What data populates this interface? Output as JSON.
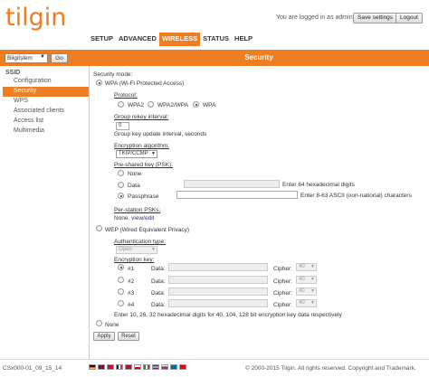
{
  "brand": {
    "logo": "tilgin"
  },
  "header": {
    "logged_text": "You are logged in as admin.",
    "save_label": "Save settings",
    "logout_label": "Logout"
  },
  "nav": [
    "SETUP",
    "ADVANCED",
    "WIRELESS",
    "STATUS",
    "HELP"
  ],
  "nav_active": "WIRELESS",
  "page_title": "Security",
  "ssid_select": {
    "value": "Bilgiİşlem",
    "go_label": "Go"
  },
  "sidebar": {
    "heading": "SSID",
    "items": [
      "Configuration",
      "Security",
      "WPS",
      "Associated clients",
      "Access list",
      "Multimedia"
    ],
    "active": "Security"
  },
  "security": {
    "mode_label": "Security mode:",
    "wpa_label": "WPA (Wi-Fi Protected Access)",
    "protocol_label": "Protocol:",
    "protocols": [
      "WPA2",
      "WPA2/WPA",
      "WPA"
    ],
    "protocol_selected": "WPA",
    "rekey_label": "Group rekey interval:",
    "rekey_value": "0",
    "rekey_help": "Group key update interval, seconds",
    "enc_label": "Encryption algorithm:",
    "enc_value": "TKIP/CCMP",
    "psk_label": "Pre-shared key (PSK):",
    "psk_none": "None",
    "psk_data": "Data",
    "psk_data_help": "Enter 64 hexadecimal digits",
    "psk_pass": "Passphrase",
    "psk_pass_help": "Enter 8-63 ASCII (non-national) characters",
    "per_station_label": "Per-station PSKs:",
    "per_station_value": "None.",
    "view_edit": "view/edit",
    "wep_label": "WEP (Wired Equivalent Privacy)",
    "auth_label": "Authentication type:",
    "auth_value": "Open",
    "enc_key_label": "Encryption key:",
    "keys": [
      {
        "label": "#1",
        "data": "Data:",
        "cipher": "Cipher:",
        "cipher_value": "40"
      },
      {
        "label": "#2",
        "data": "Data:",
        "cipher": "Cipher:",
        "cipher_value": "40"
      },
      {
        "label": "#3",
        "data": "Data:",
        "cipher": "Cipher:",
        "cipher_value": "40"
      },
      {
        "label": "#4",
        "data": "Data:",
        "cipher": "Cipher:",
        "cipher_value": "40"
      }
    ],
    "wep_help": "Enter 10, 26, 32 hexadecimal digits for 40, 104, 128 bit encryption key data respectively",
    "none_label": "None",
    "apply_label": "Apply",
    "reset_label": "Reset"
  },
  "footer": {
    "version": "CSx000-01_09_15_14",
    "copyright": "© 2000-2015 Tilgin. All rights reserved. Copyright and Trademark."
  },
  "colors": {
    "accent": "#ef7d22"
  }
}
